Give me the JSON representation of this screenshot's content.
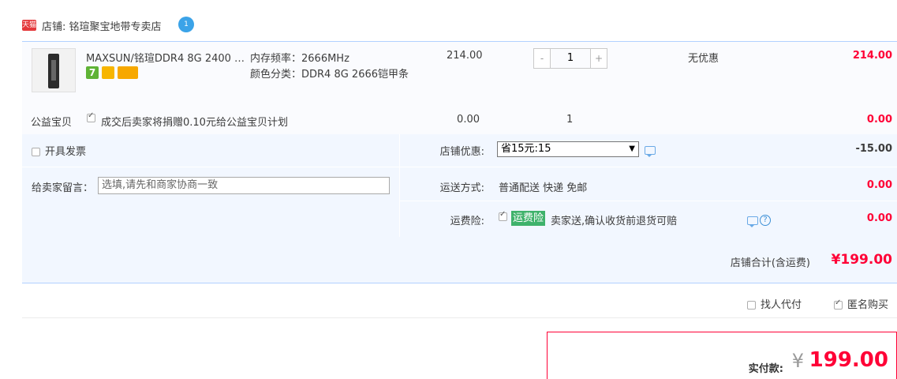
{
  "shop": {
    "badge": "天猫",
    "label": "店铺: 铭瑄聚宝地带专卖店",
    "chat_badge": "1"
  },
  "item": {
    "title": "MAXSUN/铭瑄DDR4 8G 2400 2...",
    "props": [
      "内存频率：2666MHz",
      "颜色分类：DDR4 8G 2666铠甲条"
    ],
    "badges": [
      "7"
    ],
    "price": "214.00",
    "qty": {
      "minus": "-",
      "value": "1",
      "plus": "+"
    },
    "promo": "无优惠",
    "subtotal": "214.00"
  },
  "charity": {
    "label": "公益宝贝",
    "text": "成交后卖家将捐赠0.10元给公益宝贝计划",
    "price": "0.00",
    "qty": "1",
    "total": "0.00"
  },
  "options": {
    "invoice_label": "开具发票",
    "note_label": "给卖家留言：",
    "note_placeholder": "选填,请先和商家协商一致",
    "coupon_label": "店铺优惠:",
    "coupon_selected": "省15元:15",
    "coupon_value": "-15.00",
    "shipping_label": "运送方式:",
    "shipping_text": "普通配送 快递 免邮",
    "shipping_value": "0.00",
    "insurance_label": "运费险:",
    "insurance_tag": "运费险",
    "insurance_text": "卖家送,确认收货前退货可赔",
    "insurance_value": "0.00"
  },
  "shop_total": {
    "label": "店铺合计(含运费)",
    "value": "¥199.00"
  },
  "extra": {
    "proxy_label": "找人代付",
    "anonymous_label": "匿名购买"
  },
  "payment": {
    "label": "实付款:",
    "currency": "¥",
    "value": "199.00"
  },
  "colors": {
    "accent_red": "#ff0036",
    "border_blue": "#b2d1ff",
    "row_bg": "#f2f7ff",
    "insurance_green": "#3fb26b"
  }
}
